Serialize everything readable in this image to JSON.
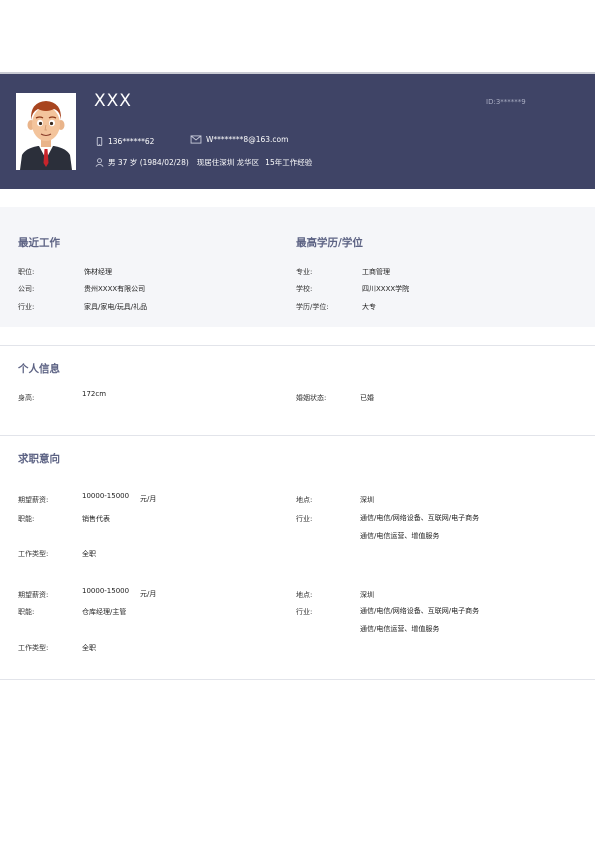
{
  "profile": {
    "name": "XXX",
    "id_text": "ID:3******9",
    "phone": "136******62",
    "email": "W********8@163.com",
    "basic_info": "男 37 岁 (1984/02/28)",
    "residence": "现居住深圳 龙华区",
    "experience": "15年工作经验"
  },
  "recent_work": {
    "title": "最近工作",
    "fields": [
      {
        "label": "职位:",
        "value": "饰材经理"
      },
      {
        "label": "公司:",
        "value": "贵州XXXX有限公司"
      },
      {
        "label": "行业:",
        "value": "家具/家电/玩具/礼品"
      }
    ]
  },
  "education": {
    "title": "最高学历/学位",
    "fields": [
      {
        "label": "专业:",
        "value": "工商管理"
      },
      {
        "label": "学校:",
        "value": "四川XXXX学院"
      },
      {
        "label": "学历/学位:",
        "value": "大专"
      }
    ]
  },
  "personal": {
    "title": "个人信息",
    "height_label": "身高:",
    "height_value": "172cm",
    "marital_label": "婚姻状态:",
    "marital_value": "已婚"
  },
  "intention": {
    "title": "求职意向",
    "entries": [
      {
        "salary_label": "期望薪资:",
        "salary_value": "10000-15000",
        "salary_unit": "元/月",
        "function_label": "职能:",
        "function_value": "销售代表",
        "worktype_label": "工作类型:",
        "worktype_value": "全职",
        "location_label": "地点:",
        "location_value": "深圳",
        "industry_label": "行业:",
        "industry_line1": "通信/电信/网络设备、互联网/电子商务",
        "industry_line2": "通信/电信运营、增值服务"
      },
      {
        "salary_label": "期望薪资:",
        "salary_value": "10000-15000",
        "salary_unit": "元/月",
        "function_label": "职能:",
        "function_value": "仓库经理/主管",
        "worktype_label": "工作类型:",
        "worktype_value": "全职",
        "location_label": "地点:",
        "location_value": "深圳",
        "industry_label": "行业:",
        "industry_line1": "通信/电信/网络设备、互联网/电子商务",
        "industry_line2": "通信/电信运营、增值服务"
      }
    ]
  },
  "colors": {
    "header_bg": "#3f4466",
    "section_title": "#5d6384"
  }
}
